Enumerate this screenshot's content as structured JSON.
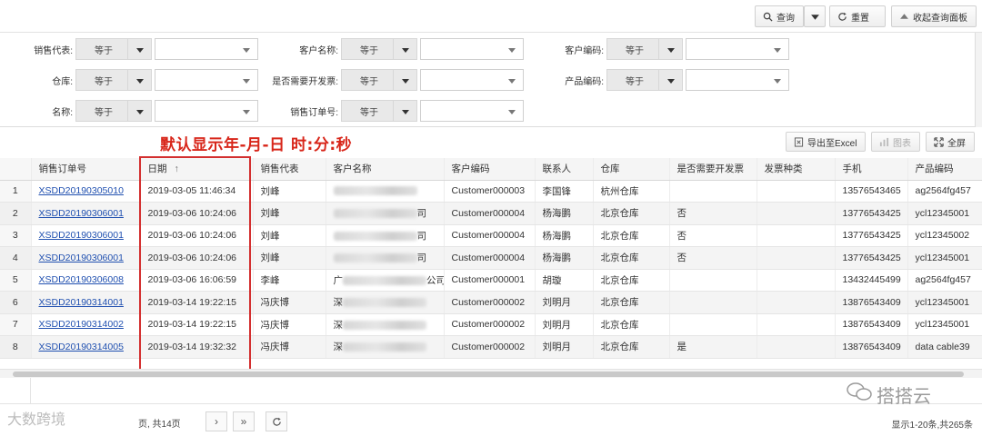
{
  "toolbar": {
    "query_label": "查询",
    "reset_label": "重置",
    "collapse_label": "收起查询面板"
  },
  "filters": {
    "row1": [
      {
        "label": "销售代表:",
        "op": "等于"
      },
      {
        "label": "客户名称:",
        "op": "等于"
      },
      {
        "label": "客户编码:",
        "op": "等于"
      }
    ],
    "row2": [
      {
        "label": "仓库:",
        "op": "等于"
      },
      {
        "label": "是否需要开发票:",
        "op": "等于"
      },
      {
        "label": "产品编码:",
        "op": "等于"
      }
    ],
    "row3": [
      {
        "label": "名称:",
        "op": "等于"
      },
      {
        "label": "销售订单号:",
        "op": "等于"
      }
    ]
  },
  "annotation": "默认显示年-月-日 时:分:秒",
  "grid_toolbar": {
    "export_label": "导出至Excel",
    "chart_label": "图表",
    "fullscreen_label": "全屏"
  },
  "columns": [
    "销售订单号",
    "日期",
    "销售代表",
    "客户名称",
    "客户编码",
    "联系人",
    "仓库",
    "是否需要开发票",
    "发票种类",
    "手机",
    "产品编码"
  ],
  "sort_arrow": "↑",
  "rows": [
    {
      "n": "1",
      "order": "XSDD20190305010",
      "date": "2019-03-05 11:46:34",
      "rep": "刘峰",
      "cust_prefix": "",
      "cust_suffix": "",
      "code": "Customer000003",
      "contact": "李国锋",
      "wh": "杭州仓库",
      "invoice": "",
      "itype": "",
      "phone": "13576543465",
      "prod": "ag2564fg457"
    },
    {
      "n": "2",
      "order": "XSDD20190306001",
      "date": "2019-03-06 10:24:06",
      "rep": "刘峰",
      "cust_prefix": "",
      "cust_suffix": "司",
      "code": "Customer000004",
      "contact": "杨海鹏",
      "wh": "北京仓库",
      "invoice": "否",
      "itype": "",
      "phone": "13776543425",
      "prod": "ycl12345001"
    },
    {
      "n": "3",
      "order": "XSDD20190306001",
      "date": "2019-03-06 10:24:06",
      "rep": "刘峰",
      "cust_prefix": "",
      "cust_suffix": "司",
      "code": "Customer000004",
      "contact": "杨海鹏",
      "wh": "北京仓库",
      "invoice": "否",
      "itype": "",
      "phone": "13776543425",
      "prod": "ycl12345002"
    },
    {
      "n": "4",
      "order": "XSDD20190306001",
      "date": "2019-03-06 10:24:06",
      "rep": "刘峰",
      "cust_prefix": "",
      "cust_suffix": "司",
      "code": "Customer000004",
      "contact": "杨海鹏",
      "wh": "北京仓库",
      "invoice": "否",
      "itype": "",
      "phone": "13776543425",
      "prod": "ycl12345001"
    },
    {
      "n": "5",
      "order": "XSDD20190306008",
      "date": "2019-03-06 16:06:59",
      "rep": "李峰",
      "cust_prefix": "广",
      "cust_suffix": "公司",
      "code": "Customer000001",
      "contact": "胡璇",
      "wh": "北京仓库",
      "invoice": "",
      "itype": "",
      "phone": "13432445499",
      "prod": "ag2564fg457"
    },
    {
      "n": "6",
      "order": "XSDD20190314001",
      "date": "2019-03-14 19:22:15",
      "rep": "冯庆博",
      "cust_prefix": "深",
      "cust_suffix": "",
      "code": "Customer000002",
      "contact": "刘明月",
      "wh": "北京仓库",
      "invoice": "",
      "itype": "",
      "phone": "13876543409",
      "prod": "ycl12345001"
    },
    {
      "n": "7",
      "order": "XSDD20190314002",
      "date": "2019-03-14 19:22:15",
      "rep": "冯庆博",
      "cust_prefix": "深",
      "cust_suffix": "",
      "code": "Customer000002",
      "contact": "刘明月",
      "wh": "北京仓库",
      "invoice": "",
      "itype": "",
      "phone": "13876543409",
      "prod": "ycl12345001"
    },
    {
      "n": "8",
      "order": "XSDD20190314005",
      "date": "2019-03-14 19:32:32",
      "rep": "冯庆博",
      "cust_prefix": "深",
      "cust_suffix": "",
      "code": "Customer000002",
      "contact": "刘明月",
      "wh": "北京仓库",
      "invoice": "是",
      "itype": "",
      "phone": "13876543409",
      "prod": "data cable39"
    }
  ],
  "pager": {
    "page_text": "页, 共14页",
    "info": "显示1-20条,共265条"
  },
  "watermarks": {
    "left": "大数跨境",
    "right": "搭搭云"
  }
}
